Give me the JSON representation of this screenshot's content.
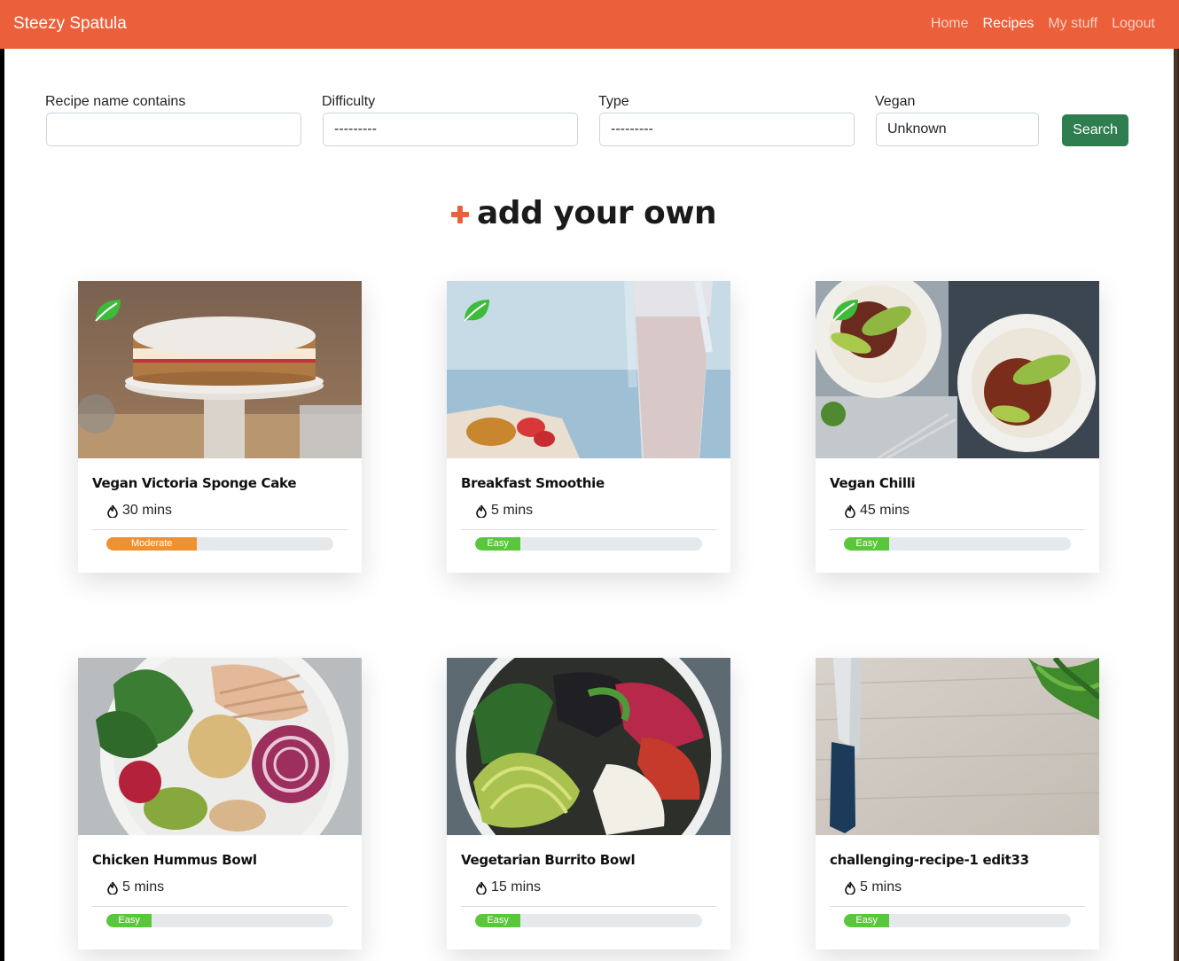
{
  "navbar": {
    "brand": "Steezy Spatula",
    "links": [
      {
        "label": "Home"
      },
      {
        "label": "Recipes"
      },
      {
        "label": "My stuff"
      },
      {
        "label": "Logout"
      }
    ]
  },
  "filters": {
    "name_label": "Recipe name contains",
    "name_value": "",
    "difficulty_label": "Difficulty",
    "difficulty_value": "---------",
    "type_label": "Type",
    "type_value": "---------",
    "vegan_label": "Vegan",
    "vegan_value": "Unknown",
    "search_label": "Search"
  },
  "add_own": {
    "label": "add your own"
  },
  "colors": {
    "brand": "#eb5f3a",
    "search_button": "#2e7d4e",
    "difficulty_moderate": "#ef9130",
    "difficulty_easy": "#59c73b",
    "vegan_leaf": "#3dbb3a"
  },
  "recipes": [
    {
      "title": "Vegan Victoria Sponge Cake",
      "time": "30 mins",
      "difficulty": "Moderate",
      "difficulty_fraction": 0.4,
      "vegan": true,
      "image": "sponge-cake"
    },
    {
      "title": "Breakfast Smoothie",
      "time": "5 mins",
      "difficulty": "Easy",
      "difficulty_fraction": 0.2,
      "vegan": true,
      "image": "smoothie"
    },
    {
      "title": "Vegan Chilli",
      "time": "45 mins",
      "difficulty": "Easy",
      "difficulty_fraction": 0.2,
      "vegan": true,
      "image": "chilli"
    },
    {
      "title": "Chicken Hummus Bowl",
      "time": "5 mins",
      "difficulty": "Easy",
      "difficulty_fraction": 0.2,
      "vegan": false,
      "image": "hummus-bowl"
    },
    {
      "title": "Vegetarian Burrito Bowl",
      "time": "15 mins",
      "difficulty": "Easy",
      "difficulty_fraction": 0.2,
      "vegan": false,
      "image": "burrito-bowl"
    },
    {
      "title": "challenging-recipe-1 edit33",
      "time": "5 mins",
      "difficulty": "Easy",
      "difficulty_fraction": 0.2,
      "vegan": false,
      "image": "wood-board"
    }
  ]
}
